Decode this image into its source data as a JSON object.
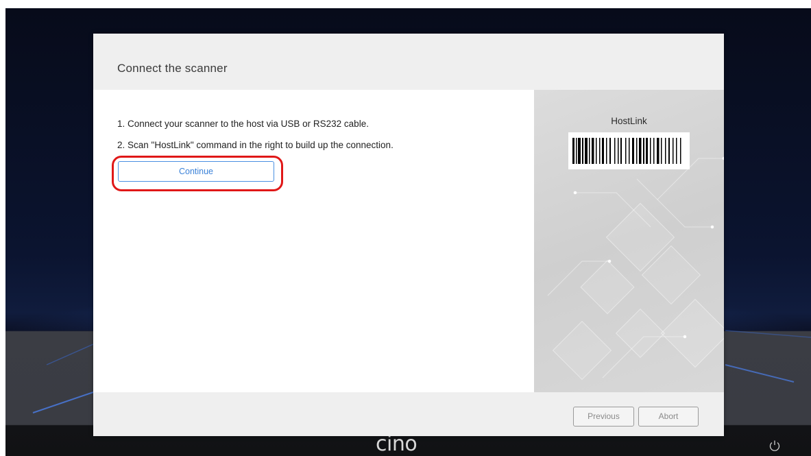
{
  "dialog": {
    "title": "Connect the scanner",
    "steps": [
      "1. Connect your scanner to the host via USB or RS232 cable.",
      "2. Scan \"HostLink\" command in the right to build up the connection."
    ],
    "continue_label": "Continue",
    "barcode_label": "HostLink"
  },
  "footer": {
    "previous_label": "Previous",
    "abort_label": "Abort"
  },
  "taskbar": {
    "brand": "cino"
  },
  "colors": {
    "accent": "#3b82d8",
    "highlight": "#e01818",
    "header_bg": "#efefef"
  },
  "icons": {
    "power": "power-icon"
  }
}
